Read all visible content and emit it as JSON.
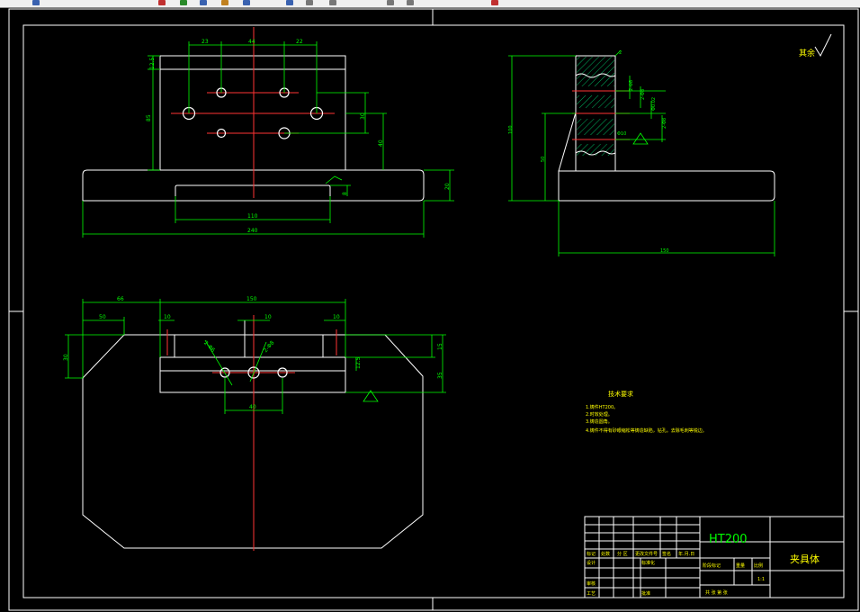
{
  "title_block": {
    "material": "HT200",
    "part_name": "夹具体",
    "row_labels": [
      "标记",
      "处数",
      "分 区",
      "更改文件号",
      "签名",
      "年.月.日"
    ],
    "designer": "设计",
    "standardization": "标准化",
    "stage_mark": "阶段标记",
    "weight": "重量",
    "ratio": "比例",
    "ratio_value": "1:1",
    "review": "审核",
    "process": "工艺",
    "approve": "批准",
    "sheet": "共  张  第  张"
  },
  "roughness_note": "其余",
  "technical_requirements": {
    "title": "技术要求",
    "lines": [
      "1.铸件HT200。",
      "2.时效处理。",
      "3.铸造圆角。",
      "4.铸件不得有砂眼缩松等铸造缺陷，钻孔。去除毛刺等锐边。"
    ]
  },
  "dimensions": {
    "top_view": [
      "23",
      "44",
      "22",
      "12.5",
      "85",
      "30",
      "40",
      "20",
      "8",
      "110",
      "240"
    ],
    "side_view": [
      "2",
      "100",
      "50",
      "150",
      "2-Φ8",
      "2-Φ8",
      "Φ0.02",
      "Φ10",
      "2-Φ8"
    ],
    "front_view": [
      "66",
      "50",
      "10",
      "150",
      "10",
      "10",
      "30",
      "15",
      "35",
      "12.5",
      "40",
      "2-Φ6",
      "2-Φ8"
    ]
  },
  "icons": [
    "toolbar-icons",
    "roughness-symbol"
  ]
}
